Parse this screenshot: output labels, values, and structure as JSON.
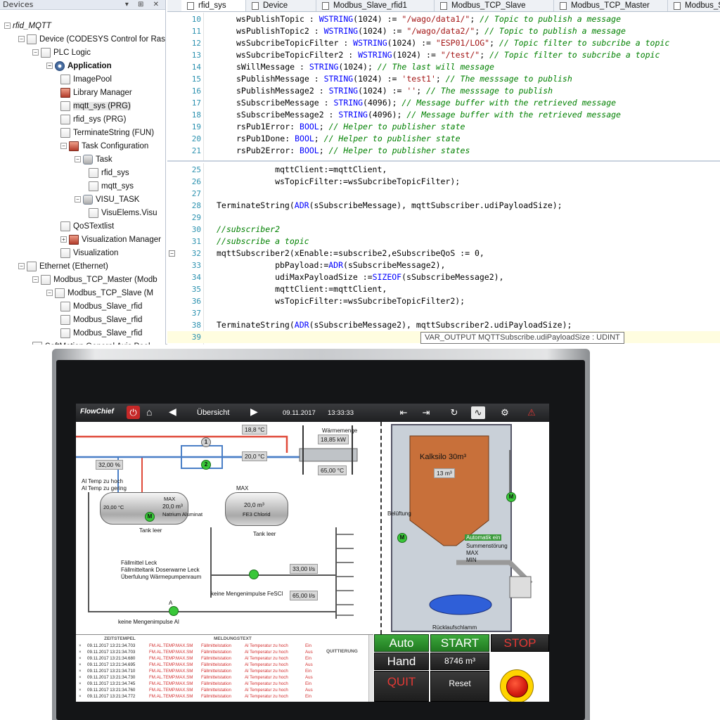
{
  "devices_pane": {
    "title": "Devices",
    "tree": [
      {
        "label": "rfid_MQTT",
        "italic": true
      },
      {
        "label": "Device (CODESYS Control for Raspb"
      },
      {
        "label": "PLC Logic"
      },
      {
        "label": "Application",
        "bold": true
      },
      {
        "label": "ImagePool"
      },
      {
        "label": "Library Manager"
      },
      {
        "label": "mqtt_sys (PRG)"
      },
      {
        "label": "rfid_sys (PRG)"
      },
      {
        "label": "TerminateString (FUN)"
      },
      {
        "label": "Task Configuration"
      },
      {
        "label": "Task"
      },
      {
        "label": "rfid_sys"
      },
      {
        "label": "mqtt_sys"
      },
      {
        "label": "VISU_TASK"
      },
      {
        "label": "VisuElems.Visu"
      },
      {
        "label": "QoSTextlist"
      },
      {
        "label": "Visualization Manager"
      },
      {
        "label": "Visualization"
      },
      {
        "label": "Ethernet (Ethernet)"
      },
      {
        "label": "Modbus_TCP_Master (Modb"
      },
      {
        "label": "Modbus_TCP_Slave (M"
      },
      {
        "label": "Modbus_Slave_rfid"
      },
      {
        "label": "Modbus_Slave_rfid"
      },
      {
        "label": "Modbus_Slave_rfid"
      },
      {
        "label": "SoftMotion General Axis Pool"
      }
    ]
  },
  "editor": {
    "tabs": [
      "rfid_sys",
      "Device",
      "Modbus_Slave_rfid1",
      "Modbus_TCP_Slave",
      "Modbus_TCP_Master",
      "Modbus_S"
    ],
    "top_lines": [
      {
        "n": "10",
        "code": "wsPublishTopic : WSTRING(1024) := \"/wago/data1/\"; // Topic to publish a message"
      },
      {
        "n": "11",
        "code": "wsPublishTopic2 : WSTRING(1024) := \"/wago/data2/\"; // Topic to publish a message"
      },
      {
        "n": "12",
        "code": "wsSubcribeTopicFilter : WSTRING(1024) := \"ESP01/LOG\"; // Topic filter to subcribe a topic"
      },
      {
        "n": "13",
        "code": "wsSubcribeTopicFilter2 : WSTRING(1024) := \"/test/\"; // Topic filter to subcribe a topic"
      },
      {
        "n": "14",
        "code": "sWillMessage : STRING(1024); // The last will message"
      },
      {
        "n": "15",
        "code": "sPublishMessage : STRING(1024) := 'test1'; // The messsage to publish"
      },
      {
        "n": "16",
        "code": "sPublishMessage2 : STRING(1024) := ''; // The messsage to publish"
      },
      {
        "n": "17",
        "code": "sSubscribeMessage : STRING(4096); // Message buffer with the retrieved message"
      },
      {
        "n": "18",
        "code": "sSubscribeMessage2 : STRING(4096); // Message buffer with the retrieved message"
      },
      {
        "n": "19",
        "code": "rsPub1Error: BOOL; // Helper to publisher state"
      },
      {
        "n": "20",
        "code": "rsPub1Done: BOOL; // Helper to publisher state"
      },
      {
        "n": "21",
        "code": "rsPub2Error: BOOL; // Helper to publisher states"
      }
    ],
    "bottom_lines": [
      {
        "n": "25",
        "code": "            mqttClient:=mqttClient,"
      },
      {
        "n": "26",
        "code": "            wsTopicFilter:=wsSubcribeTopicFilter);"
      },
      {
        "n": "27",
        "code": ""
      },
      {
        "n": "28",
        "code": "TerminateString(ADR(sSubscribeMessage), mqttSubscriber.udiPayloadSize);"
      },
      {
        "n": "29",
        "code": ""
      },
      {
        "n": "30",
        "code": "//subscriber2"
      },
      {
        "n": "31",
        "code": "//subscribe a topic"
      },
      {
        "n": "32",
        "code": "mqttSubscriber2(xEnable:=subscribe2,eSubscribeQoS := 0,"
      },
      {
        "n": "33",
        "code": "            pbPayload:=ADR(sSubscribeMessage2),"
      },
      {
        "n": "34",
        "code": "            udiMaxPayloadSize :=SIZEOF(sSubscribeMessage2),"
      },
      {
        "n": "35",
        "code": "            mqttClient:=mqttClient,"
      },
      {
        "n": "36",
        "code": "            wsTopicFilter:=wsSubcribeTopicFilter2);"
      },
      {
        "n": "37",
        "code": ""
      },
      {
        "n": "38",
        "code": "TerminateString(ADR(sSubscribeMessage2), mqttSubscriber2.udiPayloadSize);"
      },
      {
        "n": "39",
        "code": ""
      }
    ],
    "tooltip": "VAR_OUTPUT MQTTSubscribe.udiPayloadSize : UDINT"
  },
  "hmi": {
    "topbar": {
      "logo": "FlowChief",
      "title": "Übersicht",
      "date": "09.11.2017",
      "time": "13:33:33"
    },
    "process": {
      "temp1": "18,8 °C",
      "temp2": "20,0 °C",
      "waermemenge_label": "Wärmemenge",
      "waermemenge_value": "18,85 kW",
      "temp3": "65,00 °C",
      "percent": "32,00 %",
      "al_temp_hoch": "Al Temp zu hoch",
      "al_temp_gering": "Al Temp zu gering",
      "tank1_temp": "20,00 °C",
      "tank1_value": "20,0 m³",
      "tank1_name": "Natrium Aluminat",
      "tank1_max": "MAX",
      "tank1_leer": "Tank leer",
      "tank2_value": "20,0 m³",
      "tank2_name": "FE3 Chlorid",
      "tank2_max": "MAX",
      "tank2_leer": "Tank leer",
      "flow1": "33,00 l/s",
      "flow2": "65,00 l/s",
      "msg1": "Fällmittel Leck",
      "msg2": "Fällmitteltank Doserwarne Leck",
      "msg3": "Überfulung Wärmepumpenraum",
      "msg4": "keine Mengenimpulse FeSCl",
      "msg5": "keine Mengenimpulse Al",
      "pump_label": "A",
      "pump_m": "M"
    },
    "silo": {
      "name": "Kalksilo 30m³",
      "level": "13 m³",
      "belueftung": "Belüftung",
      "auto": "Automatik ein",
      "stoerung": "Summenstörung",
      "max": "MAX",
      "min": "MIN",
      "rueck": "Rücklaufschlamm"
    },
    "alarms": {
      "col_ts": "ZEITSTEMPEL",
      "col_msg": "MELDUNGSTEXT",
      "col_ack": "QUITTIERUNG",
      "rows": [
        {
          "ts": "09.11.2017 13:21:34.703",
          "code": "FM.AL.TEMP.MAX.SM",
          "src": "Fällmittelstation",
          "txt": "Al Temperatur zu hoch",
          "st": "Ein"
        },
        {
          "ts": "09.11.2017 13:21:34.703",
          "code": "FM.AL.TEMP.MAX.SM",
          "src": "Fällmittelstation",
          "txt": "Al Temperatur zu hoch",
          "st": "Aus"
        },
        {
          "ts": "09.11.2017 13:21:34.680",
          "code": "FM.AL.TEMP.MAX.SM",
          "src": "Fällmittelstation",
          "txt": "Al Temperatur zu hoch",
          "st": "Ein"
        },
        {
          "ts": "09.11.2017 13:21:34.695",
          "code": "FM.AL.TEMP.MAX.SM",
          "src": "Fällmittelstation",
          "txt": "Al Temperatur zu hoch",
          "st": "Aus"
        },
        {
          "ts": "09.11.2017 13:21:34.710",
          "code": "FM.AL.TEMP.MAX.SM",
          "src": "Fällmittelstation",
          "txt": "Al Temperatur zu hoch",
          "st": "Ein"
        },
        {
          "ts": "09.11.2017 13:21:34.730",
          "code": "FM.AL.TEMP.MAX.SM",
          "src": "Fällmittelstation",
          "txt": "Al Temperatur zu hoch",
          "st": "Aus"
        },
        {
          "ts": "09.11.2017 13:21:34.745",
          "code": "FM.AL.TEMP.MAX.SM",
          "src": "Fällmittelstation",
          "txt": "Al Temperatur zu hoch",
          "st": "Ein"
        },
        {
          "ts": "09.11.2017 13:21:34.760",
          "code": "FM.AL.TEMP.MAX.SM",
          "src": "Fällmittelstation",
          "txt": "Al Temperatur zu hoch",
          "st": "Aus"
        },
        {
          "ts": "09.11.2017 13:21:34.772",
          "code": "FM.AL.TEMP.MAX.SM",
          "src": "Fällmittelstation",
          "txt": "Al Temperatur zu hoch",
          "st": "Ein"
        }
      ]
    },
    "controls": {
      "auto": "Auto",
      "start": "START",
      "stop": "STOP",
      "hand": "Hand",
      "volume": "8746 m³",
      "quit": "QUIT",
      "reset": "Reset"
    }
  },
  "colors": {
    "keyword": "#0000ff",
    "comment": "#008000",
    "string": "#a31515",
    "line_number": "#2b91af",
    "hmi_green": "#2e8b2e",
    "alarm_red": "#d32f2f",
    "copper_silo": "#c8703a"
  }
}
